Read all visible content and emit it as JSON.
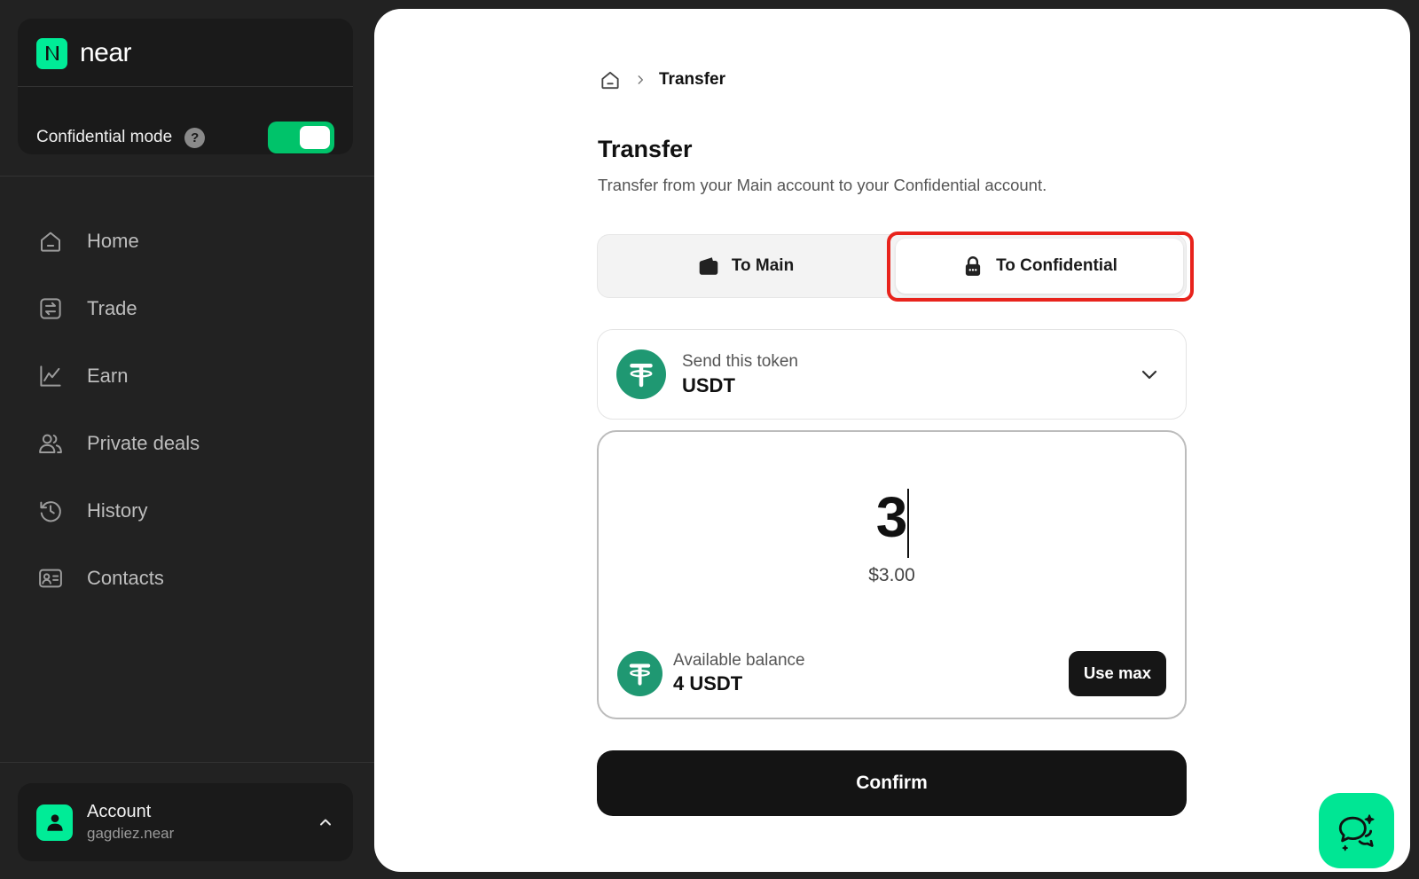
{
  "brand": {
    "name": "near",
    "logo_icon": "near-logo-icon",
    "accent": "#00ec97"
  },
  "confidential": {
    "label": "Confidential mode",
    "help_glyph": "?",
    "enabled": true,
    "toggle_color": "#00c36a"
  },
  "nav": {
    "items": [
      {
        "label": "Home",
        "icon": "home-icon"
      },
      {
        "label": "Trade",
        "icon": "trade-icon"
      },
      {
        "label": "Earn",
        "icon": "chart-line-icon"
      },
      {
        "label": "Private deals",
        "icon": "users-icon"
      },
      {
        "label": "History",
        "icon": "history-icon"
      },
      {
        "label": "Contacts",
        "icon": "contacts-icon"
      }
    ]
  },
  "account": {
    "title": "Account",
    "id": "gagdiez.near"
  },
  "breadcrumb": {
    "current": "Transfer"
  },
  "page": {
    "title": "Transfer",
    "subtitle": "Transfer from your Main account to your Confidential account."
  },
  "direction": {
    "to_main_label": "To Main",
    "to_confidential_label": "To Confidential",
    "selected": "To Confidential",
    "highlight_color": "#e8231c"
  },
  "token": {
    "label": "Send this token",
    "value": "USDT",
    "icon": "tether-icon",
    "color": "#1f9872"
  },
  "amount": {
    "value": "3",
    "usd": "$3.00"
  },
  "balance": {
    "label": "Available balance",
    "value": "4 USDT"
  },
  "actions": {
    "use_max": "Use max",
    "confirm": "Confirm"
  }
}
